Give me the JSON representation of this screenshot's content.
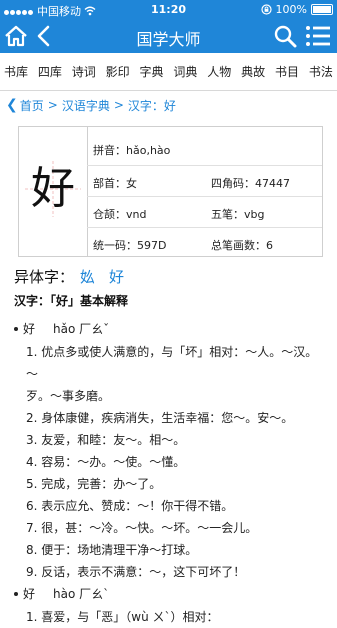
{
  "status": {
    "carrier": "中国移动",
    "time": "11:20",
    "battery": "100%"
  },
  "nav": {
    "title": "国学大师"
  },
  "categories": [
    "书库",
    "四库",
    "诗词",
    "影印",
    "字典",
    "词典",
    "人物",
    "典故",
    "书目",
    "书法"
  ],
  "breadcrumb": [
    "首页",
    "汉语字典",
    "汉字：好"
  ],
  "card": {
    "char": "好",
    "pinyin": "拼音：hǎo,hào",
    "bushou": "部首：女",
    "sijiao": "四角码：47447",
    "cangjie": "仓颉：vnd",
    "wubi": "五笔：vbg",
    "unicode": "统一码：597D",
    "strokes": "总笔画数：6"
  },
  "variants": {
    "label": "异体字：",
    "items": [
      "𡚸",
      "好"
    ]
  },
  "basic_title": "汉字：「好」基本解释",
  "pron1": {
    "char": "好",
    "pinyin": "hǎo 厂ㄠˇ"
  },
  "defs1": [
    "1. 优点多或使人满意的，与「坏」相对：～人。～汉。～",
    "歹。～事多磨。",
    "2. 身体康健，疾病消失，生活幸福：您～。安～。",
    "3. 友爱，和睦：友～。相～。",
    "4. 容易：～办。～使。～懂。",
    "5. 完成，完善：办～了。",
    "6. 表示应允、赞成：～！你干得不错。",
    "7. 很，甚：～冷。～快。～坏。～一会儿。",
    "8. 便于：场地清理干净～打球。",
    "9. 反话，表示不满意：～，这下可坏了！"
  ],
  "pron2": {
    "char": "好",
    "pinyin": "hào 厂ㄠˋ"
  },
  "defs2": [
    "1. 喜爱，与「恶」（wù ㄨˋ）相对："
  ]
}
